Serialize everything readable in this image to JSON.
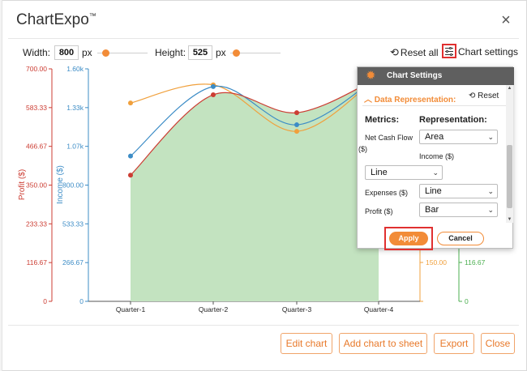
{
  "app": {
    "title": "ChartExpo",
    "trademark": "™",
    "close_glyph": "×"
  },
  "controls": {
    "width_label": "Width:",
    "width_value": "800",
    "width_unit": "px",
    "height_label": "Height:",
    "height_value": "525",
    "height_unit": "px",
    "reset_all_label": "Reset all",
    "chart_settings_label": "Chart settings"
  },
  "chart_data": {
    "type": "area",
    "categories": [
      "Quarter-1",
      "Quarter-2",
      "Quarter-3",
      "Quarter-4"
    ],
    "series": [
      {
        "name": "Net Cash Flow",
        "representation": "Area",
        "color": "#c3e3c0"
      },
      {
        "name": "Income",
        "representation": "Line",
        "color": "#3c8cc6",
        "values": [
          1000,
          1478,
          1215,
          null
        ]
      },
      {
        "name": "Expenses",
        "representation": "Line",
        "color": "#f0a03c",
        "values": [
          1365,
          1490,
          1170,
          null
        ]
      },
      {
        "name": "Profit",
        "representation": "Bar",
        "color": "#cc3d33",
        "values": [
          380,
          622,
          568,
          null
        ]
      }
    ],
    "axes": {
      "profit": {
        "label": "Profit ($)",
        "ticks": [
          "700.00",
          "583.33",
          "466.67",
          "350.00",
          "233.33",
          "116.67",
          "0"
        ],
        "ylim": [
          0,
          700
        ],
        "color": "#cc3d33"
      },
      "income": {
        "label": "Income ($)",
        "ticks": [
          "1.60k",
          "1.33k",
          "1.07k",
          "800.00",
          "533.33",
          "266.67",
          "0"
        ],
        "ylim": [
          0,
          1600
        ],
        "color": "#3c8cc6"
      },
      "right_orange": {
        "ticks": [
          "150.00"
        ],
        "color": "#f0a03c"
      },
      "right_green": {
        "ticks": [
          "116.67",
          "0"
        ],
        "color": "#4caf50"
      }
    }
  },
  "settings_panel": {
    "title": "Chart Settings",
    "section_title": "Data Representation:",
    "reset_label": "Reset",
    "metrics_header": "Metrics:",
    "representation_header": "Representation:",
    "rows": {
      "net_cash_flow": {
        "label_line1": "Net Cash Flow",
        "label_line2": "($)",
        "value": "Area"
      },
      "income": {
        "label": "Income ($)",
        "value": "Line"
      },
      "expenses": {
        "label": "Expenses ($)",
        "value": "Line"
      },
      "profit": {
        "label": "Profit ($)",
        "value": "Bar"
      }
    },
    "apply_label": "Apply",
    "cancel_label": "Cancel"
  },
  "footer": {
    "edit_chart": "Edit chart",
    "add_to_sheet": "Add chart to sheet",
    "export": "Export",
    "close": "Close"
  }
}
